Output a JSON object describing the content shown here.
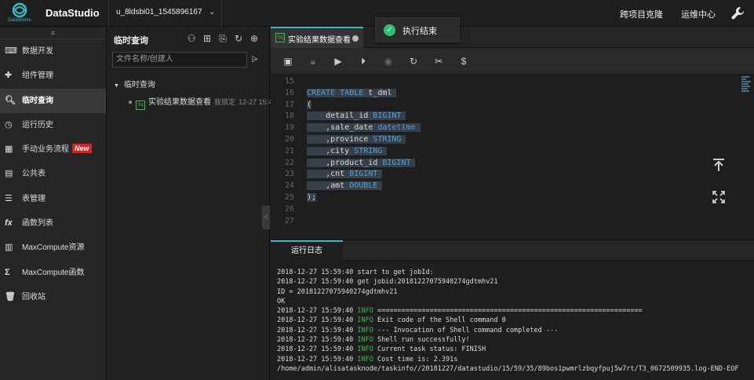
{
  "topbar": {
    "logo_sub": "DataWorks",
    "app_title": "DataStudio",
    "project": "u_8ldsbi01_1545896167",
    "nav_right": [
      "跨项目克隆",
      "运维中心"
    ],
    "toast": "执行结束"
  },
  "sidebar": {
    "items": [
      {
        "label": "数据开发",
        "icon": "code-icon"
      },
      {
        "label": "组件管理",
        "icon": "puzzle-icon"
      },
      {
        "label": "临时查询",
        "icon": "search-icon",
        "active": true
      },
      {
        "label": "运行历史",
        "icon": "clock-icon"
      },
      {
        "label": "手动业务流程",
        "icon": "flow-icon",
        "badge": "New"
      },
      {
        "label": "公共表",
        "icon": "table-icon"
      },
      {
        "label": "表管理",
        "icon": "table-manage-icon"
      },
      {
        "label": "函数列表",
        "icon": "fx-icon"
      },
      {
        "label": "MaxCompute资源",
        "icon": "resource-icon"
      },
      {
        "label": "MaxCompute函数",
        "icon": "sigma-icon"
      },
      {
        "label": "回收站",
        "icon": "trash-icon"
      }
    ]
  },
  "midpanel": {
    "title": "临时查询",
    "search_placeholder": "文件名称/创建人",
    "tree_root": "临时查询",
    "file_name": "实验结果数据查看",
    "file_lock": "我锁定",
    "file_time": "12-27 15:4"
  },
  "editor": {
    "tab_label": "实验结果数据查看",
    "lines": [
      {
        "n": "15",
        "parts": []
      },
      {
        "n": "16",
        "parts": [
          {
            "t": "CREATE TABLE ",
            "kw": true
          },
          {
            "t": "t_dml "
          }
        ],
        "hl": true
      },
      {
        "n": "17",
        "parts": [
          {
            "t": "("
          }
        ],
        "hl": true
      },
      {
        "n": "18",
        "parts": [
          {
            "t": "    detail_id "
          },
          {
            "t": "BIGINT ",
            "kw": true
          }
        ],
        "hl": true
      },
      {
        "n": "19",
        "parts": [
          {
            "t": "    ,sale_date "
          },
          {
            "t": "datetime ",
            "kw": true
          }
        ],
        "hl": true
      },
      {
        "n": "20",
        "parts": [
          {
            "t": "    ,province "
          },
          {
            "t": "STRING ",
            "kw": true
          }
        ],
        "hl": true
      },
      {
        "n": "21",
        "parts": [
          {
            "t": "    ,city "
          },
          {
            "t": "STRING ",
            "kw": true
          }
        ],
        "hl": true
      },
      {
        "n": "22",
        "parts": [
          {
            "t": "    ,product_id "
          },
          {
            "t": "BIGINT ",
            "kw": true
          }
        ],
        "hl": true
      },
      {
        "n": "23",
        "parts": [
          {
            "t": "    ,cnt "
          },
          {
            "t": "BIGINT ",
            "kw": true
          }
        ],
        "hl": true
      },
      {
        "n": "24",
        "parts": [
          {
            "t": "    ,amt "
          },
          {
            "t": "DOUBLE ",
            "kw": true
          }
        ],
        "hl": true
      },
      {
        "n": "25",
        "parts": [
          {
            "t": ");"
          }
        ],
        "hl": true
      },
      {
        "n": "26",
        "parts": []
      },
      {
        "n": "27",
        "parts": []
      }
    ]
  },
  "log": {
    "tab_label": "运行日志",
    "lines": [
      {
        "ts": "2018-12-27 15:59:40",
        "level": "",
        "msg": "start to get jobId:"
      },
      {
        "ts": "2018-12-27 15:59:40",
        "level": "",
        "msg": "get jobid:20181227075940274gdtmhv21"
      },
      {
        "ts": "",
        "level": "",
        "msg": "ID = 20181227075940274gdtmhv21"
      },
      {
        "ts": "",
        "level": "",
        "msg": "OK"
      },
      {
        "ts": "2018-12-27 15:59:40",
        "level": "INFO",
        "msg": "=================================================================="
      },
      {
        "ts": "2018-12-27 15:59:40",
        "level": "INFO",
        "msg": "Exit code of the Shell command 0"
      },
      {
        "ts": "2018-12-27 15:59:40",
        "level": "INFO",
        "msg": "--- Invocation of Shell command completed ---"
      },
      {
        "ts": "2018-12-27 15:59:40",
        "level": "INFO",
        "msg": "Shell run successfully!"
      },
      {
        "ts": "2018-12-27 15:59:40",
        "level": "INFO",
        "msg": "Current task status: FINISH"
      },
      {
        "ts": "2018-12-27 15:59:40",
        "level": "INFO",
        "msg": "Cost time is: 2.391s"
      },
      {
        "ts": "",
        "level": "",
        "msg": "/home/admin/alisatasknode/taskinfo//20181227/datastudio/15/59/35/89bos1pwmrlzbqyfpuj5w7rt/T3_0672509935.log-END-EOF"
      }
    ]
  }
}
